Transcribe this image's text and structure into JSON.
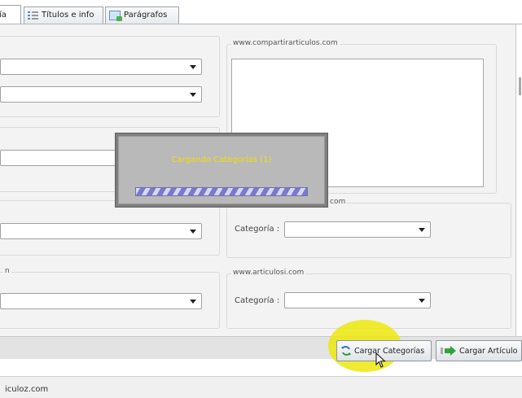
{
  "tabs": [
    {
      "label": "ía",
      "active": true
    },
    {
      "label": "Títulos e info",
      "icon": "list-icon"
    },
    {
      "label": "Parágrafos",
      "icon": "paragraph-icon"
    }
  ],
  "sites": {
    "compartir": {
      "title": "www.compartirarticulos.com"
    },
    "third": {
      "title_suffix": "com",
      "category_label": "Categoría :",
      "category_value": ""
    },
    "articulosi": {
      "title": "www.articulosi.com",
      "category_label": "Categoría :",
      "category_value": ""
    }
  },
  "left_groups": {
    "fourth_title": "n"
  },
  "loading": {
    "text": "Cargando Categorías (1)",
    "progress_style": "marquee"
  },
  "buttons": {
    "load_categories": "Cargar Categorías",
    "load_article": "Cargar Artículo"
  },
  "status": {
    "text": "iculoz.com"
  },
  "colors": {
    "highlight": "#ECE80C",
    "loading_text": "#F0E00A"
  }
}
